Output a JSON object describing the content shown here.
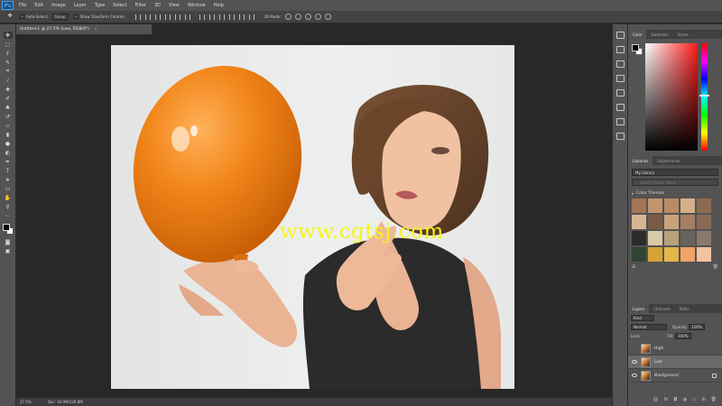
{
  "app": {
    "logo": "Ps"
  },
  "menu": [
    "File",
    "Edit",
    "Image",
    "Layer",
    "Type",
    "Select",
    "Filter",
    "3D",
    "View",
    "Window",
    "Help"
  ],
  "options": {
    "auto_select_label": "Auto-Select:",
    "auto_select_value": "Group",
    "transform_label": "Show Transform Controls",
    "mode_label": "3D Mode:"
  },
  "document": {
    "tab_title": "Untitled-1 @ 27.5% (Low, RGB/8*)",
    "close": "×",
    "zoom": "27.5%",
    "doc_size": "Doc: 30.9M/120.8M"
  },
  "watermark": "www.cgtsj.com",
  "color_panel": {
    "tabs": [
      "Color",
      "Swatches",
      "Styles"
    ]
  },
  "libraries_panel": {
    "tabs": [
      "Libraries",
      "Adjustments"
    ],
    "library_name": "My Library",
    "search_placeholder": "Search Adobe Stock",
    "section_title": "Color Themes",
    "swatches": [
      "#a47456",
      "#c2956e",
      "#b98a66",
      "#d4b08a",
      "#8c6b52",
      "#d9b493",
      "#7a5b45",
      "#c9a27c",
      "#a57f61",
      "#8a6a55",
      "#2e2b2a",
      "#d8c9a8",
      "#b8a27c",
      "#6a625c",
      "#8a7a6d",
      "#2f4434",
      "#d6a336",
      "#e3b648",
      "#f0a36a",
      "#f3c2a2"
    ]
  },
  "layers_panel": {
    "tabs": [
      "Layers",
      "Channels",
      "Paths"
    ],
    "kind_label": "Kind",
    "blend_mode": "Normal",
    "opacity_label": "Opacity:",
    "opacity_value": "100%",
    "lock_label": "Lock:",
    "fill_label": "Fill:",
    "fill_value": "100%",
    "layers": [
      {
        "name": "High",
        "visible": false,
        "selected": false
      },
      {
        "name": "Low",
        "visible": true,
        "selected": true
      },
      {
        "name": "Background",
        "visible": true,
        "selected": false
      }
    ],
    "footer_icons": [
      "link-icon",
      "fx-icon",
      "mask-icon",
      "adjustment-icon",
      "folder-icon",
      "new-layer-icon",
      "trash-icon"
    ]
  },
  "colors": {
    "ui_dark": "#282828",
    "ui_panel": "#535353",
    "ps_blue": "#31a8ff",
    "balloon": "#f08a1e",
    "watermark": "#f5f51b"
  }
}
